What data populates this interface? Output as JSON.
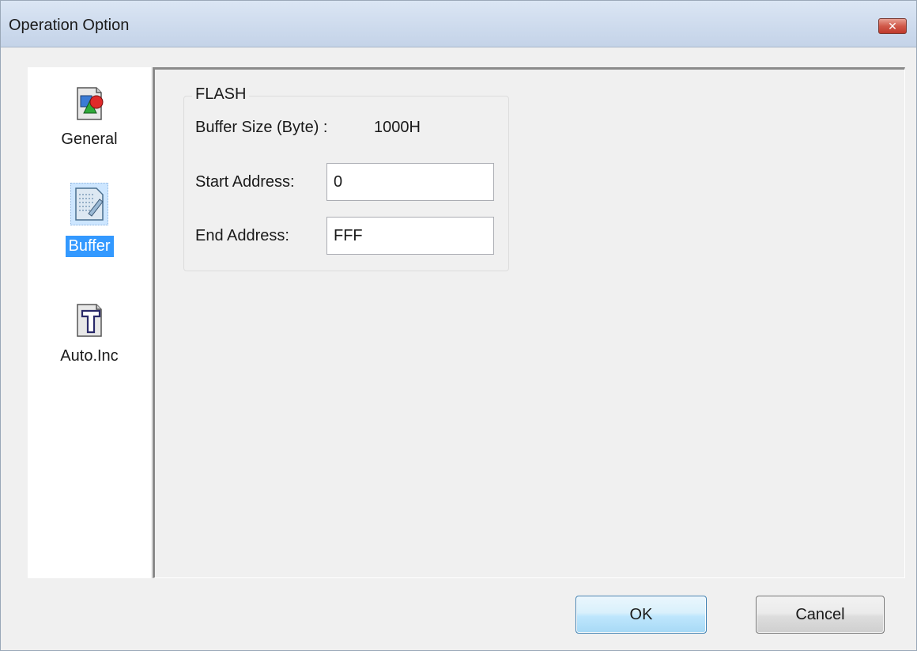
{
  "window": {
    "title": "Operation Option",
    "close_glyph": "✕"
  },
  "nav": {
    "items": [
      {
        "label": "General",
        "icon": "general-shapes-icon"
      },
      {
        "label": "Buffer",
        "icon": "buffer-edit-icon",
        "selected": true
      },
      {
        "label": "Auto.Inc",
        "icon": "auto-inc-t-icon"
      }
    ]
  },
  "flash": {
    "group_title": "FLASH",
    "buffer_size_label": "Buffer Size (Byte) :",
    "buffer_size_value": "1000H",
    "start_address_label": "Start Address:",
    "start_address_value": "0",
    "end_address_label": "End Address:",
    "end_address_value": "FFF"
  },
  "buttons": {
    "ok_label": "OK",
    "cancel_label": "Cancel"
  },
  "colors": {
    "selected_highlight": "#3399ff",
    "close_button": "#c0392b"
  }
}
